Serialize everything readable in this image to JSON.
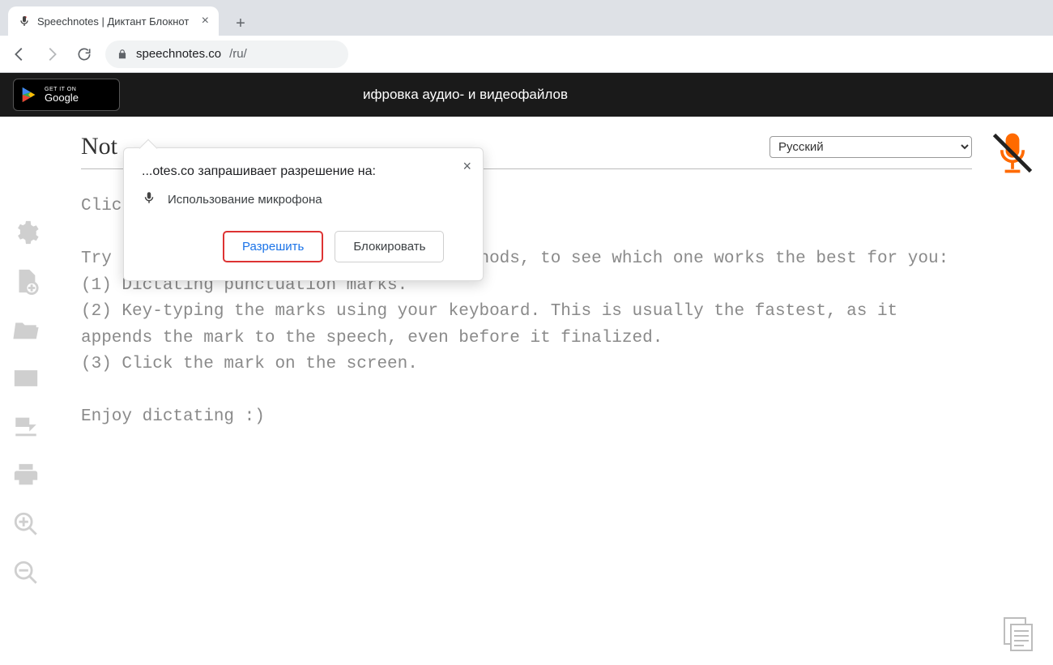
{
  "browser": {
    "tab_title": "Speechnotes | Диктант Блокнот",
    "url_host": "speechnotes.co",
    "url_path": "/ru/"
  },
  "banner": {
    "google_play_small": "GET IT ON",
    "google_play_big": "Google",
    "link_text": "ифровка аудио- и видеофайлов"
  },
  "page": {
    "note_title": "Not",
    "language_selected": "Русский",
    "editor_text": "Click the mic to start dictating.\n\nTry the following three punctuation methods, to see which one works the best for you:\n(1) Dictating punctuation marks.\n(2) Key-typing the marks using your keyboard. This is usually the fastest, as it appends the mark to the speech, even before it finalized.\n(3) Click the mark on the screen.\n\nEnjoy dictating :)"
  },
  "popup": {
    "title": "...otes.co запрашивает разрешение на:",
    "mic_label": "Использование микрофона",
    "allow": "Разрешить",
    "block": "Блокировать"
  },
  "icons": {
    "settings": "settings",
    "new_doc": "new-doc",
    "open": "open-folder",
    "mail": "mail",
    "export": "export",
    "print": "print",
    "zoom_in": "zoom-in",
    "zoom_out": "zoom-out",
    "copy": "copy-docs"
  }
}
